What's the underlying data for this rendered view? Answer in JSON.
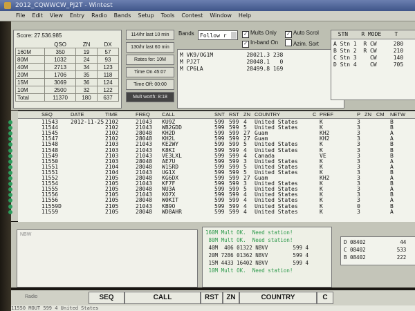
{
  "window": {
    "title": "2012_CQWWCW_PJ2T - Wintest"
  },
  "menu": [
    "File",
    "Edit",
    "View",
    "Entry",
    "Radio",
    "Bands",
    "Setup",
    "Tools",
    "Contest",
    "Window",
    "Help"
  ],
  "score": {
    "label": "Score: 27.536.985",
    "headers": [
      "",
      "QSO",
      "ZN",
      "DX"
    ],
    "rows": [
      [
        "160M",
        "350",
        "19",
        "57"
      ],
      [
        "80M",
        "1032",
        "24",
        "93"
      ],
      [
        "40M",
        "2713",
        "34",
        "123"
      ],
      [
        "20M",
        "1706",
        "35",
        "118"
      ],
      [
        "15M",
        "3069",
        "36",
        "124"
      ],
      [
        "10M",
        "2500",
        "32",
        "122"
      ],
      [
        "Total",
        "11370",
        "180",
        "637"
      ]
    ]
  },
  "rates": [
    "114/hr last 10 min",
    "130/hr last 60 min",
    "Rates for: 10M",
    "Time On 45:07",
    "Time Off: 00:00",
    "Mult worth: 8:18"
  ],
  "bands": {
    "label": "Bands",
    "value": "Follow r"
  },
  "options": {
    "mults_only": "Mults Only",
    "auto_scroll": "Auto Scrol",
    "in_band_only": "In-band On",
    "azim_sort": "Azim. Sort"
  },
  "spots": [
    "M VK9/OG1M          28021.3 238",
    "M PJ2T              28048.1   0",
    "M CP6LA             28499.8 169"
  ],
  "stations": {
    "header": "  STN    R MODE    T",
    "rows": [
      "A Stn 1  R CW     280",
      "B Stn 2  R CW     210",
      "C Stn 3    CW     140",
      "D Stn 4    CW     705"
    ]
  },
  "log": {
    "headers": [
      "SEQ",
      "DATE",
      "TIME",
      "FREQ",
      "CALL",
      "SNT",
      "RST",
      "ZN",
      "COUNTRY",
      "C",
      "PREF",
      "P",
      "ZN",
      "CM",
      "NETW"
    ],
    "rows": [
      [
        "11543",
        "2012-11-25",
        "2102",
        "21043",
        "KU9Z",
        "599",
        "599",
        "4",
        "United States",
        "",
        "K",
        "3",
        "",
        "",
        "B"
      ],
      [
        "11544",
        "",
        "2102",
        "21043",
        "WB2GDD",
        "599",
        "599",
        "5",
        "United States",
        "",
        "K",
        "3",
        "",
        "",
        "B"
      ],
      [
        "11545",
        "",
        "2102",
        "28048",
        "KH2D",
        "599",
        "599",
        "27",
        "Guam",
        "",
        "KH2",
        "3",
        "",
        "",
        "A"
      ],
      [
        "11547",
        "",
        "2102",
        "28048",
        "KH2L",
        "599",
        "599",
        "27",
        "Guam",
        "",
        "KH2",
        "3",
        "",
        "",
        "A"
      ],
      [
        "11548",
        "",
        "2103",
        "21043",
        "KE2WY",
        "599",
        "599",
        "5",
        "United States",
        "",
        "K",
        "3",
        "",
        "",
        "B"
      ],
      [
        "11548",
        "",
        "2103",
        "21043",
        "K8KI",
        "599",
        "599",
        "4",
        "United States",
        "",
        "K",
        "3",
        "",
        "",
        "B"
      ],
      [
        "11549",
        "",
        "2103",
        "21043",
        "VE3LXL",
        "599",
        "599",
        "4",
        "Canada",
        "",
        "VE",
        "3",
        "",
        "",
        "B"
      ],
      [
        "11550",
        "",
        "2103",
        "28048",
        "AE7U",
        "599",
        "599",
        "3",
        "United States",
        "",
        "K",
        "3",
        "",
        "",
        "A"
      ],
      [
        "11551",
        "",
        "2104",
        "28048",
        "W1SRD",
        "599",
        "599",
        "5",
        "United States",
        "",
        "K",
        "3",
        "",
        "",
        "A"
      ],
      [
        "11551",
        "",
        "2104",
        "21043",
        "UG1X",
        "599",
        "599",
        "5",
        "United States",
        "",
        "K",
        "3",
        "",
        "",
        "B"
      ],
      [
        "11552",
        "",
        "2105",
        "28048",
        "KG6DX",
        "599",
        "599",
        "27",
        "Guam",
        "",
        "KH2",
        "3",
        "",
        "",
        "A"
      ],
      [
        "11554",
        "",
        "2105",
        "21043",
        "KF7F",
        "599",
        "599",
        "3",
        "United States",
        "",
        "K",
        "3",
        "",
        "",
        "B"
      ],
      [
        "11555",
        "",
        "2105",
        "28048",
        "NU3A",
        "599",
        "599",
        "5",
        "United States",
        "",
        "K",
        "3",
        "",
        "",
        "A"
      ],
      [
        "11556",
        "",
        "2105",
        "21043",
        "KO7X",
        "599",
        "599",
        "4",
        "United States",
        "",
        "K",
        "3",
        "",
        "",
        "B"
      ],
      [
        "11556",
        "",
        "2105",
        "28048",
        "W0KIT",
        "599",
        "599",
        "4",
        "United States",
        "",
        "K",
        "3",
        "",
        "",
        "A"
      ],
      [
        "11559D",
        "",
        "2105",
        "21043",
        "KB9O",
        "599",
        "599",
        "4",
        "United States",
        "",
        "K",
        "0",
        "",
        "",
        "B"
      ],
      [
        "11559",
        "",
        "2105",
        "28048",
        "WD8AHR",
        "599",
        "599",
        "4",
        "United States",
        "",
        "K",
        "3",
        "",
        "",
        "A"
      ]
    ]
  },
  "notes_label": "NBW",
  "messages": [
    {
      "text": "160M Mult OK.  Need station!",
      "green": true
    },
    {
      "text": " 80M Mult OK.  Need station!",
      "green": true
    },
    {
      "text": " 40M  406 01322 N8VV        599 4",
      "green": false
    },
    {
      "text": " 20M 7286 01362 N8VV        599 4",
      "green": false
    },
    {
      "text": " 15M 4433 16402 N8VV        599 4",
      "green": false
    },
    {
      "text": " 10M Mult OK.  Need station!",
      "green": true
    }
  ],
  "dx_info": [
    "D 08402           44",
    "C 08402          533",
    "B 08402          222"
  ],
  "entry": {
    "radio_label": "Radio",
    "fields": [
      "SEQ",
      "CALL",
      "RST",
      "ZN",
      "COUNTRY",
      "C"
    ],
    "footer": "11550 MOUT        599 4 United States"
  }
}
